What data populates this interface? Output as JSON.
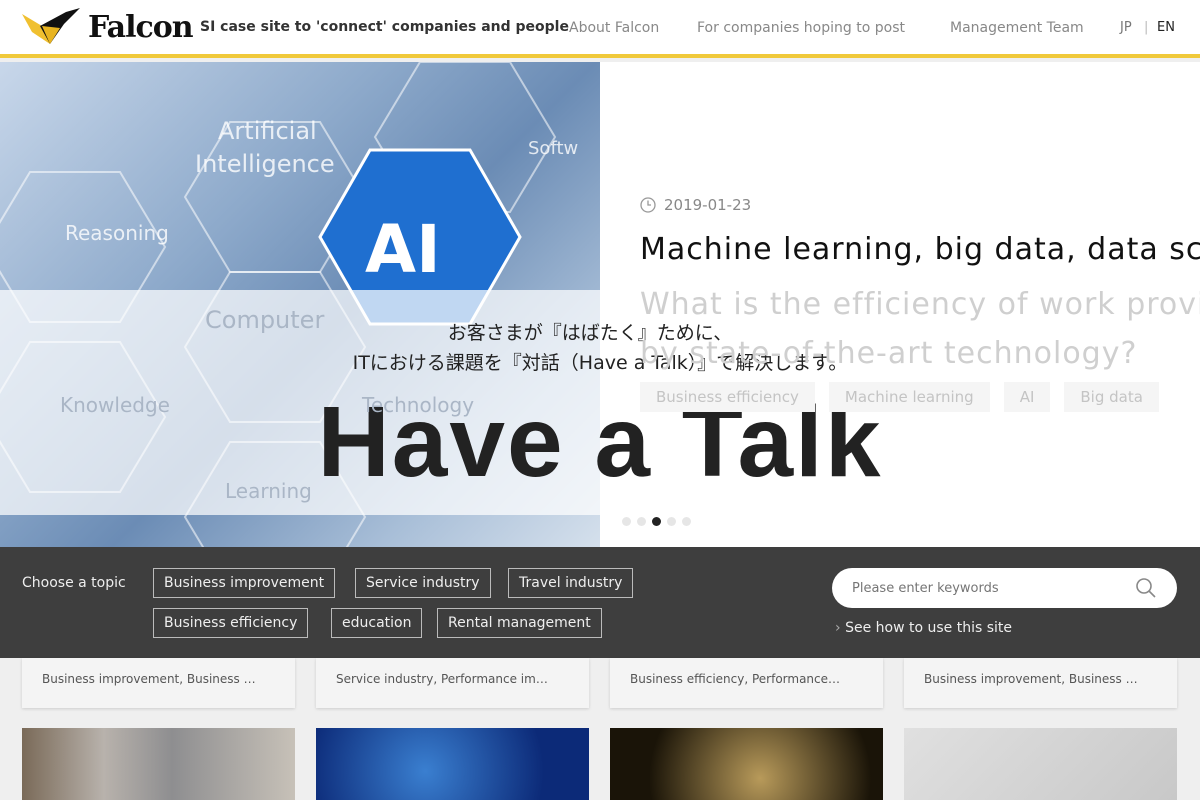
{
  "header": {
    "logo_text": "Falcon",
    "tagline": "SI case site to 'connect' companies and people",
    "nav": [
      "About Falcon",
      "For companies hoping to post",
      "Management Team"
    ],
    "lang": {
      "jp": "JP",
      "sep": "|",
      "en": "EN"
    },
    "accent_color": "#f0c93a"
  },
  "hero": {
    "image_labels": [
      "Artificial",
      "Intelligence",
      "AI",
      "Reasoning",
      "Computer",
      "Knowledge",
      "Technology",
      "Learning",
      "Softw"
    ],
    "article": {
      "date": "2019-01-23",
      "title": "Machine learning, big data, data sc",
      "subtitle_line1": "What is the efficiency of work provi",
      "subtitle_line2": "by state-of-the-art technology?",
      "tags": [
        "Business efficiency",
        "Machine learning",
        "AI",
        "Big data"
      ]
    },
    "carousel": {
      "count": 5,
      "active": 2
    },
    "overlay": {
      "line1": "お客さまが『はばたく』ために、",
      "line2": "ITにおける課題を『対話（Have a Talk）』で解決します。",
      "headline": "Have a Talk"
    }
  },
  "topics": {
    "label": "Choose a topic",
    "chips": [
      "Business improvement",
      "Service industry",
      "Travel industry",
      "Business efficiency",
      "education",
      "Rental management"
    ],
    "search_placeholder": "Please enter keywords",
    "howto": "See how to use this site"
  },
  "cards": [
    {
      "tags": "Business improvement, Business …"
    },
    {
      "tags": "Service industry, Performance im…"
    },
    {
      "tags": "Business efficiency, Performance…"
    },
    {
      "tags": "Business improvement, Business …"
    }
  ]
}
